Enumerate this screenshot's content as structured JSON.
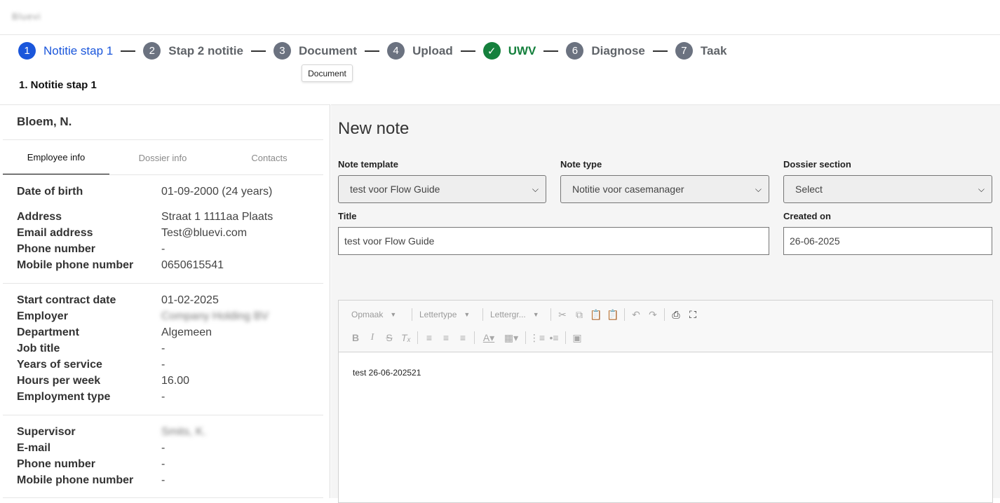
{
  "app": {
    "brand": "Bluevi"
  },
  "stepper": [
    {
      "number": "1",
      "label": "Notitie stap 1",
      "state": "active"
    },
    {
      "number": "2",
      "label": "Stap 2 notitie",
      "state": "default"
    },
    {
      "number": "3",
      "label": "Document",
      "state": "default"
    },
    {
      "number": "4",
      "label": "Upload",
      "state": "default"
    },
    {
      "number": "✓",
      "label": "UWV",
      "state": "done"
    },
    {
      "number": "6",
      "label": "Diagnose",
      "state": "default"
    },
    {
      "number": "7",
      "label": "Taak",
      "state": "default"
    }
  ],
  "tooltip": {
    "text": "Document"
  },
  "step_heading": "1. Notitie stap 1",
  "employee": {
    "name": "Bloem, N.",
    "tabs": [
      "Employee info",
      "Dossier info",
      "Contacts"
    ],
    "personal": [
      {
        "label": "Date of birth",
        "value": "01-09-2000 (24 years)"
      },
      {
        "label": "Address",
        "value": "Straat 1 1111aa Plaats"
      },
      {
        "label": "Email address",
        "value": "Test@bluevi.com"
      },
      {
        "label": "Phone number",
        "value": "-"
      },
      {
        "label": "Mobile phone number",
        "value": "0650615541"
      }
    ],
    "contract": [
      {
        "label": "Start contract date",
        "value": "01-02-2025"
      },
      {
        "label": "Employer",
        "value": "Company Holding BV"
      },
      {
        "label": "Department",
        "value": "Algemeen"
      },
      {
        "label": "Job title",
        "value": "-"
      },
      {
        "label": "Years of service",
        "value": "-"
      },
      {
        "label": "Hours per week",
        "value": "16.00"
      },
      {
        "label": "Employment type",
        "value": "-"
      }
    ],
    "supervisor": [
      {
        "label": "Supervisor",
        "value": "Smits, K."
      },
      {
        "label": "E-mail",
        "value": "-"
      },
      {
        "label": "Phone number",
        "value": "-"
      },
      {
        "label": "Mobile phone number",
        "value": "-"
      }
    ]
  },
  "note": {
    "title": "New note",
    "template_label": "Note template",
    "template_value": "test voor Flow Guide",
    "type_label": "Note type",
    "type_value": "Notitie voor casemanager",
    "section_label": "Dossier section",
    "section_value": "Select",
    "title_label": "Title",
    "title_value": "test voor Flow Guide",
    "created_label": "Created on",
    "created_value": "26-06-2025",
    "editor": {
      "format_dropdown": "Opmaak",
      "font_dropdown": "Lettertype",
      "size_dropdown": "Lettergr...",
      "content": "test 26-06-202521"
    }
  }
}
